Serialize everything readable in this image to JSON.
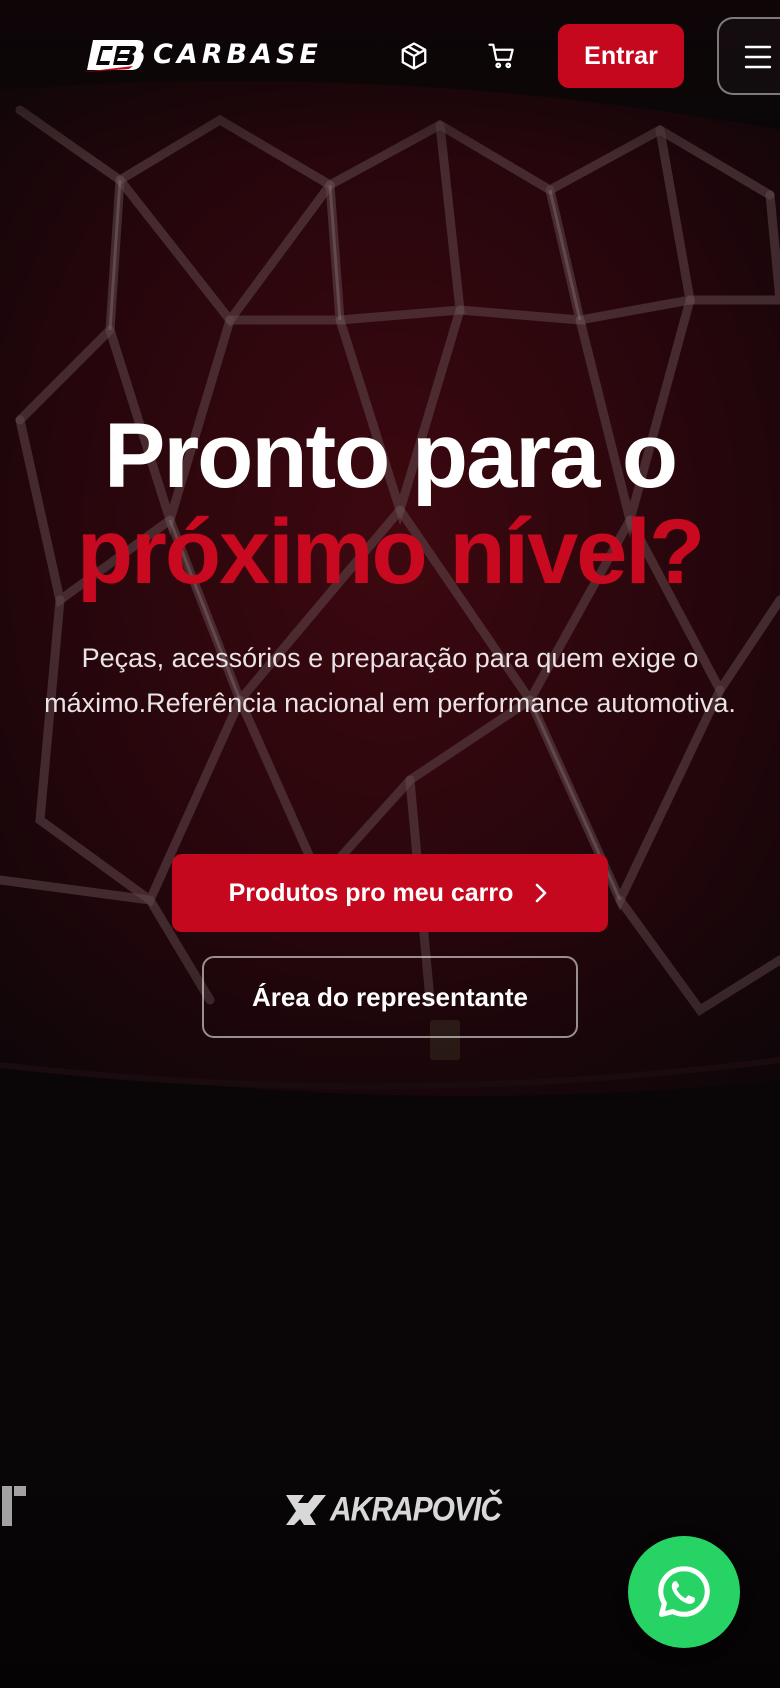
{
  "header": {
    "brand_name": "CARBASE",
    "logo_mark_text": "CB",
    "login_label": "Entrar",
    "icons": [
      "box-icon",
      "cart-icon",
      "menu-icon"
    ]
  },
  "hero": {
    "title_line1": "Pronto para o",
    "title_line2": "próximo nível?",
    "subtitle": "Peças, acessórios e preparação para quem exige o máximo.Referência nacional em performance automotiva.",
    "primary_cta": "Produtos pro meu carro",
    "secondary_cta": "Área do representante"
  },
  "brands": {
    "visible": [
      "AKRAPOVIČ"
    ]
  },
  "floating": {
    "whatsapp_icon": "whatsapp-icon"
  },
  "colors": {
    "accent": "#c5081d",
    "headline_red": "#c8091f",
    "background": "#0b0709",
    "whatsapp": "#28d366"
  }
}
